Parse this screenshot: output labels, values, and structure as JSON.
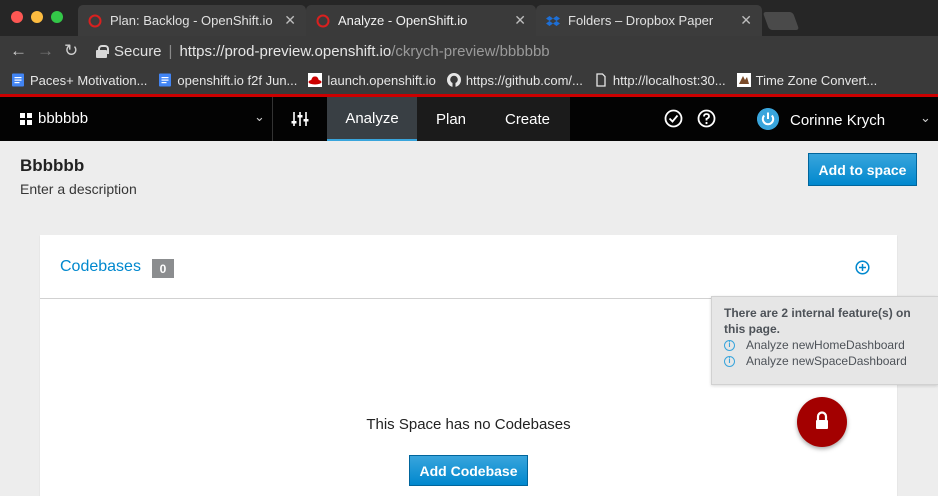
{
  "browser": {
    "tabs": [
      {
        "title": "Plan: Backlog - OpenShift.io",
        "close": "✕"
      },
      {
        "title": "Analyze - OpenShift.io",
        "close": "✕"
      },
      {
        "title": "Folders – Dropbox Paper",
        "close": "✕"
      }
    ],
    "url": {
      "secure_label": "Secure",
      "separator": "|",
      "main": "https://prod-preview.openshift.io",
      "rest": "/ckrych-preview/bbbbbb"
    },
    "bookmarks": [
      {
        "label": "Paces+ Motivation...",
        "icon": "docs-icon"
      },
      {
        "label": "openshift.io f2f Jun...",
        "icon": "docs-icon"
      },
      {
        "label": "launch.openshift.io",
        "icon": "redhat-icon"
      },
      {
        "label": "https://github.com/...",
        "icon": "github-icon"
      },
      {
        "label": "http://localhost:30...",
        "icon": "page-icon"
      },
      {
        "label": "Time Zone Convert...",
        "icon": "timezone-icon"
      }
    ],
    "accent_color": "#cc0000"
  },
  "header": {
    "space_name": "bbbbbb",
    "tabs": {
      "analyze": "Analyze",
      "plan": "Plan",
      "create": "Create"
    },
    "active_tab": "Analyze",
    "user_name": "Corinne Krych"
  },
  "page": {
    "title": "Bbbbbb",
    "description": "Enter a description",
    "add_to_space_label": "Add to space"
  },
  "codebases": {
    "title": "Codebases",
    "count": "0",
    "empty_text": "This Space has no Codebases",
    "add_label": "Add Codebase"
  },
  "features": {
    "title": "There are 2 internal feature(s) on this page.",
    "items": [
      "Analyze newHomeDashboard",
      "Analyze newSpaceDashboard"
    ]
  },
  "colors": {
    "primary": "#0088ce",
    "lock_fab": "#a30000"
  }
}
